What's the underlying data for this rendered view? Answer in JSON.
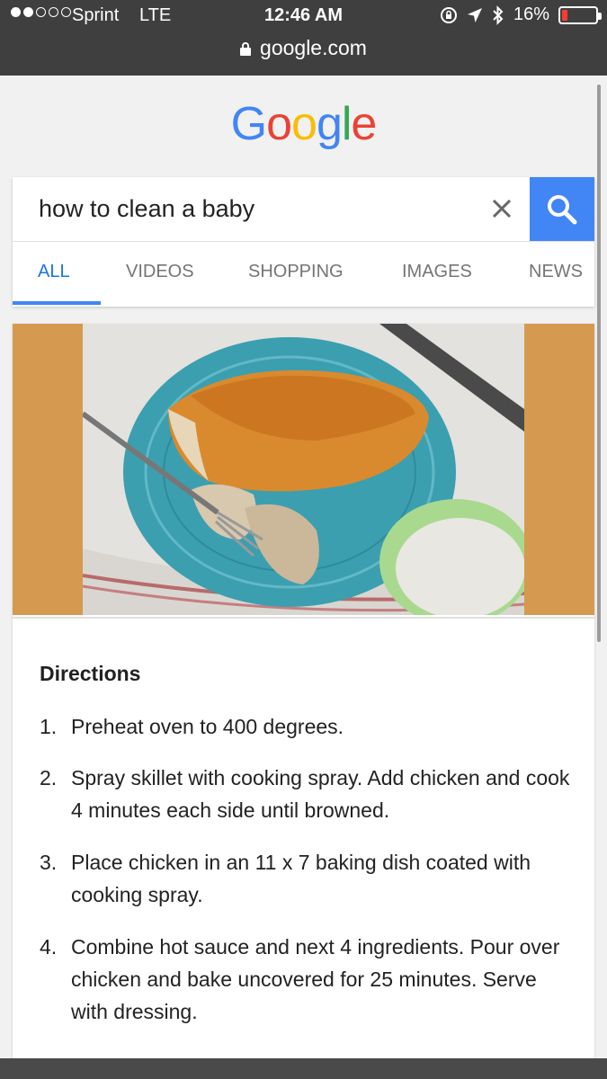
{
  "status_bar": {
    "carrier": "Sprint",
    "network": "LTE",
    "time": "12:46 AM",
    "battery_text": "16%",
    "battery_level": 0.16,
    "signal_bars_filled": 2,
    "signal_bars_total": 5,
    "battery_color": "#ff3b30"
  },
  "browser": {
    "url": "google.com"
  },
  "logo": {
    "letters": [
      "G",
      "o",
      "o",
      "g",
      "l",
      "e"
    ],
    "colors": [
      "#4285f4",
      "#ea4335",
      "#fbbc05",
      "#4285f4",
      "#34a853",
      "#ea4335"
    ]
  },
  "search": {
    "query": "how to clean a baby",
    "accent": "#4285f4"
  },
  "tabs": [
    "ALL",
    "VIDEOS",
    "SHOPPING",
    "IMAGES",
    "NEWS"
  ],
  "result": {
    "image_alt": "",
    "directions_title": "Directions",
    "steps": [
      {
        "num": "1.",
        "text": "Preheat oven to 400 degrees."
      },
      {
        "num": "2.",
        "text": "Spray skillet with cooking spray. Add chicken and cook 4 minutes each side until browned."
      },
      {
        "num": "3.",
        "text": "Place chicken in an 11 x 7 baking dish coated with cooking spray."
      },
      {
        "num": "4.",
        "text": "Combine hot sauce and next 4 ingredients. Pour over chicken and bake uncovered for 25 minutes. Serve with dressing."
      }
    ]
  }
}
